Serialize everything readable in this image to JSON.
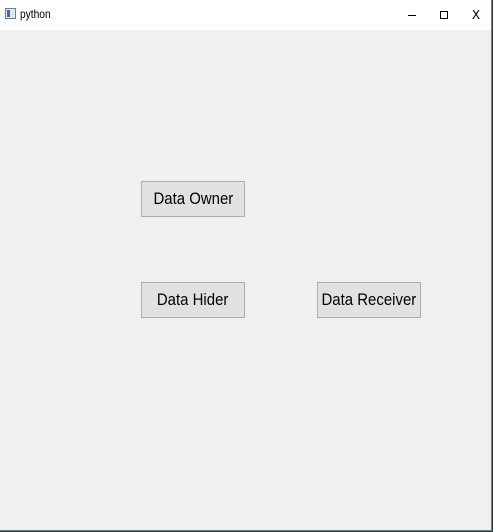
{
  "window": {
    "title": "python",
    "close_glyph": "X",
    "icons": {
      "app": "python-app-icon",
      "minimize": "minimize-icon",
      "maximize": "maximize-icon",
      "close": "close-icon"
    }
  },
  "buttons": {
    "data_owner": "Data Owner",
    "data_hider": "Data Hider",
    "data_receiver": "Data Receiver"
  },
  "colors": {
    "client_background": "#f0f0f0",
    "titlebar_background": "#ffffff",
    "button_background": "#e1e1e1",
    "button_border": "#adadad"
  }
}
